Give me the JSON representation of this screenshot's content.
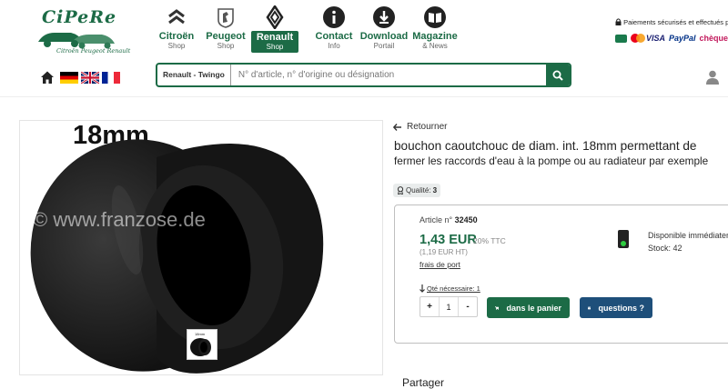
{
  "logo": {
    "name": "CiPeRe",
    "tagline": "Citroën Peugeot Renault"
  },
  "nav": [
    {
      "label": "Citroën",
      "sub": "Shop",
      "icon": "citroen-logo-icon",
      "active": false
    },
    {
      "label": "Peugeot",
      "sub": "Shop",
      "icon": "peugeot-logo-icon",
      "active": false
    },
    {
      "label": "Renault",
      "sub": "Shop",
      "icon": "renault-logo-icon",
      "active": true
    },
    {
      "label": "Contact",
      "sub": "Info",
      "icon": "contact-info-icon",
      "active": false
    },
    {
      "label": "Download",
      "sub": "Portail",
      "icon": "download-icon",
      "active": false
    },
    {
      "label": "Magazine",
      "sub": "& News",
      "icon": "magazine-icon",
      "active": false
    }
  ],
  "payment": {
    "text": "Paiements sécurisés et effectués par",
    "methods": [
      "CB",
      "Mastercard",
      "VISA",
      "PayPal",
      "chèque"
    ]
  },
  "search": {
    "scope": "Renault - Twingo",
    "placeholder": "N° d'article, n° d'origine ou désignation"
  },
  "product": {
    "image_title": "18mm",
    "watermark": "© www.franzose.de",
    "thumb_label": "18mm",
    "back": "Retourner",
    "title_line1": "bouchon caoutchouc de diam. int. 18mm permettant de",
    "title_line2": "fermer les raccords d'eau à la pompe ou au radiateur par exemple",
    "quality_label": "Qualité:",
    "quality_value": "3",
    "article_label": "Article n°",
    "article_no": "32450",
    "price": "1,43 EUR",
    "ttc": "20% TTC",
    "ht": "(1,19 EUR HT)",
    "shipping": "frais de port",
    "availability": "Disponible immédiatement",
    "stock": "Stock: 42",
    "qty_note": "Qté nécessaire: 1",
    "qty_minus": "-",
    "qty_plus": "+",
    "qty_value": "1",
    "cart_button": "dans le panier",
    "question_button": "questions ?",
    "share": "Partager"
  },
  "colors": {
    "brand_green": "#1c6b46",
    "question_blue": "#1e4f7a"
  }
}
